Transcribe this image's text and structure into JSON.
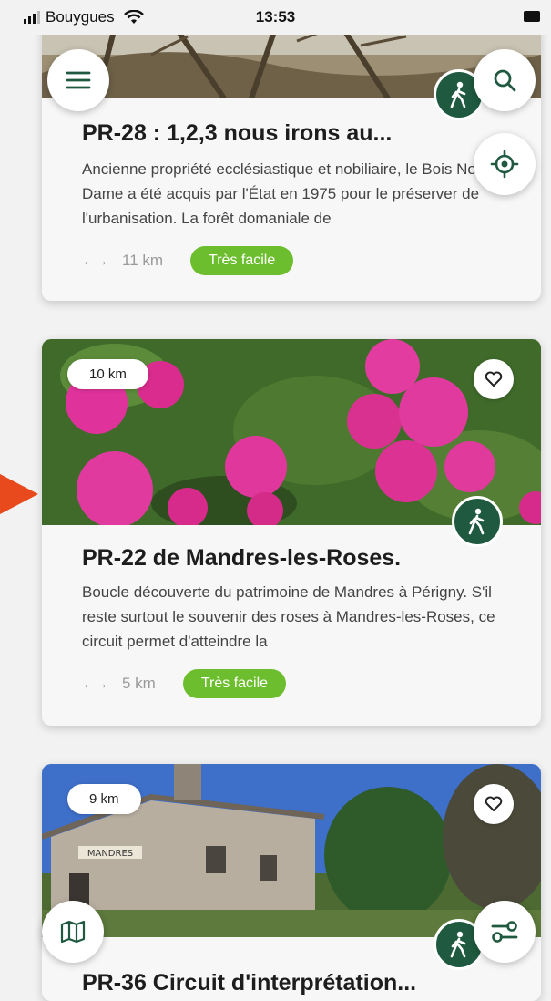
{
  "status_bar": {
    "carrier": "Bouygues",
    "time": "13:53"
  },
  "cards": [
    {
      "title": "PR-28 : 1,2,3 nous irons au...",
      "description": "Ancienne propriété ecclésiastique et nobiliaire, le Bois Notre-Dame a été acquis par l'État en 1975 pour le préserver de l'urbanisation. La forêt domaniale de",
      "distance": "11 km",
      "difficulty": "Très facile"
    },
    {
      "title": "PR-22 de Mandres-les-Roses.",
      "description": "Boucle découverte du patrimoine de Mandres à Périgny. S'il reste surtout le souvenir des roses à Mandres-les-Roses, ce circuit permet d'atteindre la",
      "distance_pill": "10 km",
      "distance": "5 km",
      "difficulty": "Très facile"
    },
    {
      "title": "PR-36 Circuit d'interprétation...",
      "distance_pill": "9 km",
      "building_sign": "MANDRES"
    }
  ],
  "icons": {
    "menu": "hamburger-menu-icon",
    "search": "search-icon",
    "locate": "crosshair-locate-icon",
    "map": "map-icon",
    "filter": "filter-sliders-icon",
    "favorite": "heart-outline-icon",
    "walk": "hiker-icon"
  },
  "colors": {
    "accent_green": "#6dbe2e",
    "dark_green": "#1f5a40",
    "marker": "#e8491d"
  }
}
